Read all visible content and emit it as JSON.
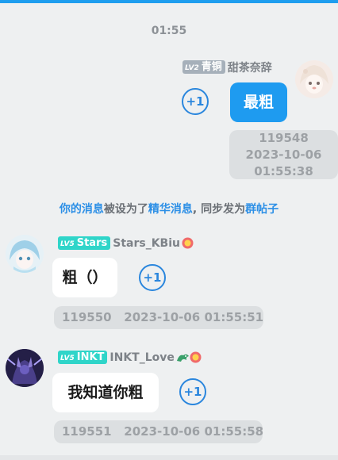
{
  "header": {
    "time": "01:55"
  },
  "messages": [
    {
      "level_badge": "LV2",
      "badge_title": "青铜",
      "nickname": "甜茶奈辞",
      "text": "最粗",
      "plus": "+1",
      "meta": {
        "id": "119548",
        "date": "2023-10-06",
        "time": "01:55:38"
      }
    },
    {
      "level_badge": "LV5",
      "badge_title": "Stars",
      "nickname": "Stars_KBiu",
      "text": "粗（）",
      "plus": "+1",
      "meta_line": "119550   2023-10-06 01:55:51"
    },
    {
      "level_badge": "LV5",
      "badge_title": "INKT",
      "nickname": "INKT_Love",
      "text": "我知道你粗",
      "plus": "+1",
      "meta_line": "119551   2023-10-06 01:55:58"
    }
  ],
  "notice": {
    "p1": "你的消息",
    "p2": "被设为了",
    "p3": "精华消息",
    "p4": ", 同步发为",
    "p5": "群帖子"
  },
  "colors": {
    "accent_blue": "#1e9bf0",
    "plus_blue": "#2a86dd",
    "badge_gray": "#a6b0ba",
    "badge_teal": "#2fd5c9",
    "background": "#eef0f1"
  },
  "icons": [
    "plus-one-icon",
    "flower-icon",
    "dragon-icon"
  ]
}
